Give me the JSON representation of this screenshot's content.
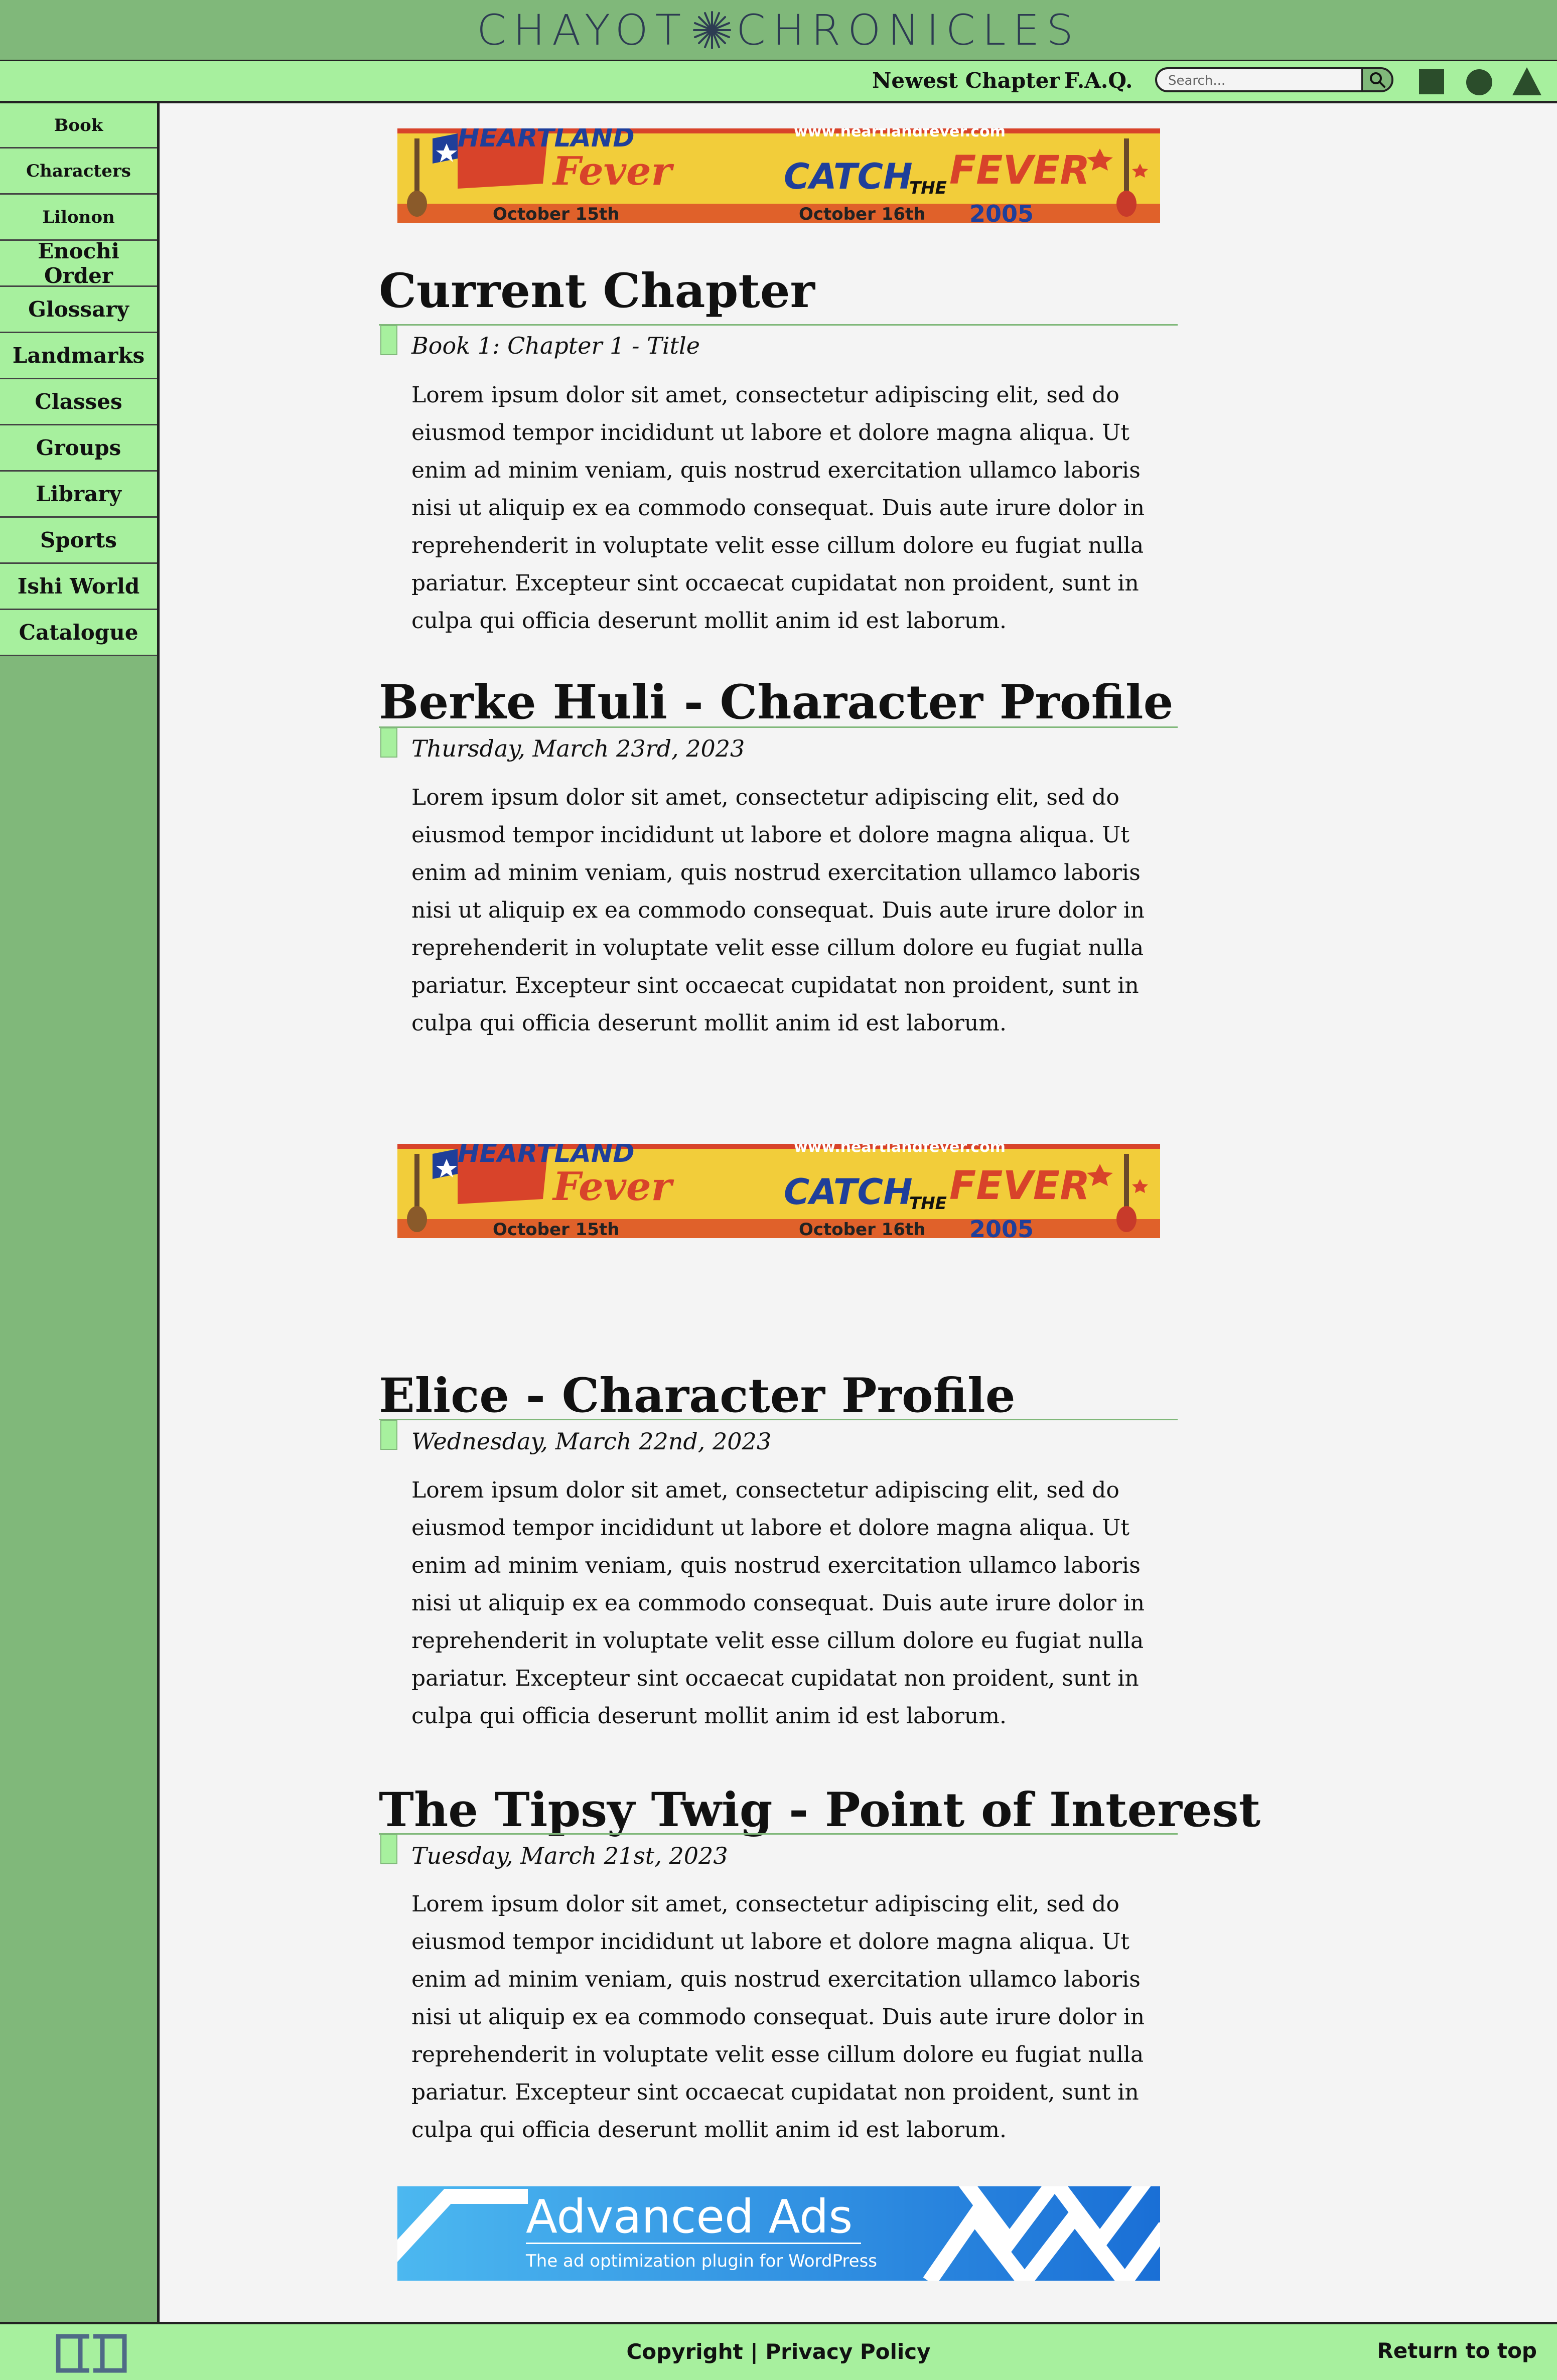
{
  "header": {
    "title_part1": "CHAYOT",
    "title_part2": "CHRONICLES"
  },
  "topnav": {
    "newest_chapter": "Newest Chapter",
    "faq": "F.A.Q.",
    "search_placeholder": "Search..."
  },
  "sidebar": {
    "items": [
      {
        "label": "Book"
      },
      {
        "label": "Characters"
      },
      {
        "label": "Lilonon"
      },
      {
        "label": "Enochi Order"
      },
      {
        "label": "Glossary"
      },
      {
        "label": "Landmarks"
      },
      {
        "label": "Classes"
      },
      {
        "label": "Groups"
      },
      {
        "label": "Library"
      },
      {
        "label": "Sports"
      },
      {
        "label": "Ishi World"
      },
      {
        "label": "Catalogue"
      }
    ]
  },
  "ads": {
    "heartland": {
      "title_top": "HEARTLAND",
      "title_script": "Fever",
      "url": "www.heartlandfever.com",
      "catch": "CATCH",
      "the": "THE",
      "fever": "FEVER",
      "date_left": "October 15th",
      "date_right": "October 16th",
      "year": "2005"
    },
    "advanced": {
      "title": "Advanced Ads",
      "subtitle": "The ad optimization plugin for WordPress"
    }
  },
  "posts": [
    {
      "title": "Current Chapter",
      "meta": "Book 1: Chapter 1 - Title",
      "body": "Lorem ipsum dolor sit amet, consectetur adipiscing elit, sed do eiusmod tempor incididunt ut labore et dolore magna aliqua. Ut enim ad minim veniam, quis nostrud exercitation ullamco laboris nisi ut aliquip ex ea commodo consequat. Duis aute irure dolor in reprehenderit in voluptate velit esse cillum dolore eu fugiat nulla pariatur. Excepteur sint occaecat cupidatat non proident, sunt in culpa qui officia deserunt mollit anim id est laborum."
    },
    {
      "title": "Berke Huli - Character Profile",
      "meta": "Thursday, March 23rd, 2023",
      "body": "Lorem ipsum dolor sit amet, consectetur adipiscing elit, sed do eiusmod tempor incididunt ut labore et dolore magna aliqua. Ut enim ad minim veniam, quis nostrud exercitation ullamco laboris nisi ut aliquip ex ea commodo consequat. Duis aute irure dolor in reprehenderit in voluptate velit esse cillum dolore eu fugiat nulla pariatur. Excepteur sint occaecat cupidatat non proident, sunt in culpa qui officia deserunt mollit anim id est laborum."
    },
    {
      "title": "Elice - Character Profile",
      "meta": "Wednesday, March 22nd, 2023",
      "body": "Lorem ipsum dolor sit amet, consectetur adipiscing elit, sed do eiusmod tempor incididunt ut labore et dolore magna aliqua. Ut enim ad minim veniam, quis nostrud exercitation ullamco laboris nisi ut aliquip ex ea commodo consequat. Duis aute irure dolor in reprehenderit in voluptate velit esse cillum dolore eu fugiat nulla pariatur. Excepteur sint occaecat cupidatat non proident, sunt in culpa qui officia deserunt mollit anim id est laborum."
    },
    {
      "title": "The Tipsy Twig - Point of Interest",
      "meta": "Tuesday, March 21st, 2023",
      "body": "Lorem ipsum dolor sit amet, consectetur adipiscing elit, sed do eiusmod tempor incididunt ut labore et dolore magna aliqua. Ut enim ad minim veniam, quis nostrud exercitation ullamco laboris nisi ut aliquip ex ea commodo consequat. Duis aute irure dolor in reprehenderit in voluptate velit esse cillum dolore eu fugiat nulla pariatur. Excepteur sint occaecat cupidatat non proident, sunt in culpa qui officia deserunt mollit anim id est laborum."
    }
  ],
  "footer": {
    "copyright": "Copyright",
    "separator": "|",
    "privacy": "Privacy Policy",
    "return_top": "Return to top"
  },
  "colors": {
    "header_green": "#80b87a",
    "nav_green": "#a7f09e",
    "title_navy": "#2d3c52",
    "icon_dark_green": "#2b4d2b",
    "background": "#f4f4f4"
  },
  "icons": {
    "title_star": "star-burst-icon",
    "search": "search-icon",
    "square": "square-icon",
    "circle": "circle-icon",
    "triangle": "triangle-icon",
    "footer_logo": "cc-logo-icon"
  }
}
